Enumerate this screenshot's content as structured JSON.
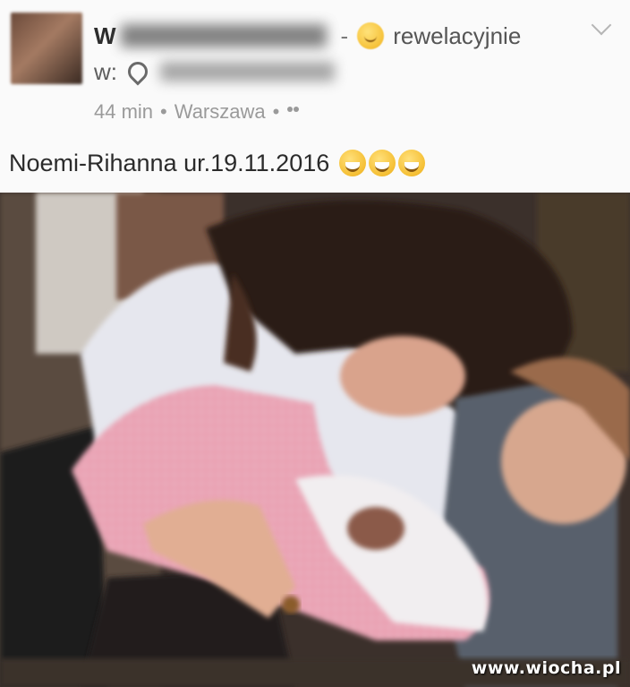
{
  "post": {
    "author_initial": "W",
    "separator": "-",
    "feeling_label": "rewelacyjnie",
    "feeling_icon": "content-emoji-icon",
    "location_prefix": "w:",
    "time_ago": "44 min",
    "city": "Warszawa",
    "meta_dot": "•",
    "audience_icon": "friends-icon",
    "text": "Noemi-Rihanna ur.19.11.2016",
    "reaction_icons": [
      "laughing-emoji-icon",
      "laughing-emoji-icon",
      "laughing-emoji-icon"
    ]
  },
  "photo": {
    "watermark": "www.wiocha.pl"
  },
  "colors": {
    "background": "#fafafa",
    "text_primary": "#2b2b2b",
    "text_secondary": "#9a9a9a",
    "emoji_yellow": "#f6c23a"
  }
}
